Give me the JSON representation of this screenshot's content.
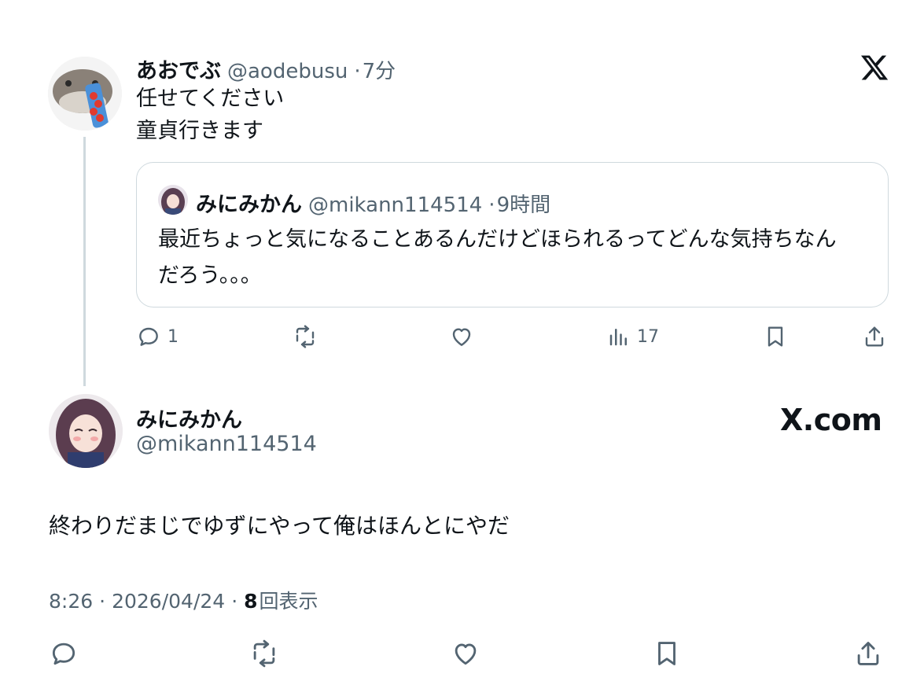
{
  "reply": {
    "display_name": "あおでぶ",
    "handle": "@aodebusu",
    "separator": "·",
    "time": "7分",
    "lines": [
      "任せてください",
      "童貞行きます"
    ],
    "quote": {
      "display_name": "みにみかん",
      "handle": "@mikann114514",
      "separator": "·",
      "time": "9時間",
      "lines": [
        "最近ちょっと気になることあるんだけどほられるってどんな気持ちなん",
        "だろう。。。"
      ]
    },
    "actions": {
      "reply_count": "1",
      "views_count": "17"
    }
  },
  "main_post": {
    "display_name": "みにみかん",
    "handle": "@mikann114514",
    "text": "終わりだまじでゆずにやって俺はほんとにやだ",
    "time": "8:26",
    "dot1": "·",
    "date": "2026/04/24",
    "dot2": "·",
    "views_number": "8",
    "views_label": "回表示"
  },
  "branding": {
    "xcom_label": "X.com"
  },
  "icons": [
    "x-logo-icon",
    "reply-icon",
    "retweet-icon",
    "like-icon",
    "views-icon",
    "bookmark-icon",
    "share-icon"
  ],
  "colors": {
    "text": "#0f1419",
    "secondary": "#536471",
    "border": "#cfd9de"
  }
}
